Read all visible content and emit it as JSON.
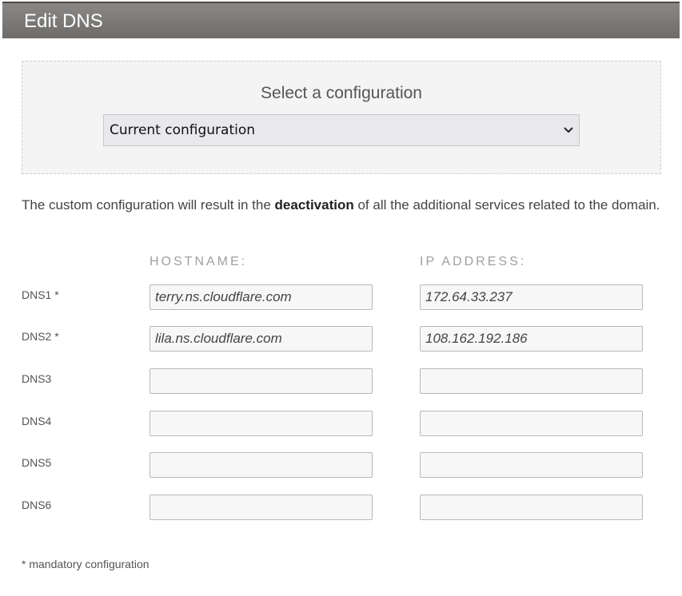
{
  "header": {
    "title": "Edit DNS"
  },
  "config": {
    "label": "Select a configuration",
    "selected": "Current configuration"
  },
  "note": {
    "before": "The custom configuration will result in the ",
    "bold": "deactivation",
    "after": " of all the additional services related to the domain."
  },
  "columns": {
    "hostname": "HOSTNAME:",
    "ip": "IP ADDRESS:"
  },
  "rows": [
    {
      "label": "DNS1 *",
      "hostname": "terry.ns.cloudflare.com",
      "ip": "172.64.33.237"
    },
    {
      "label": "DNS2 *",
      "hostname": "lila.ns.cloudflare.com",
      "ip": "108.162.192.186"
    },
    {
      "label": "DNS3",
      "hostname": "",
      "ip": ""
    },
    {
      "label": "DNS4",
      "hostname": "",
      "ip": ""
    },
    {
      "label": "DNS5",
      "hostname": "",
      "ip": ""
    },
    {
      "label": "DNS6",
      "hostname": "",
      "ip": ""
    }
  ],
  "footnote": "* mandatory configuration",
  "icons": {
    "select_arrow": "chevron-down-icon"
  }
}
